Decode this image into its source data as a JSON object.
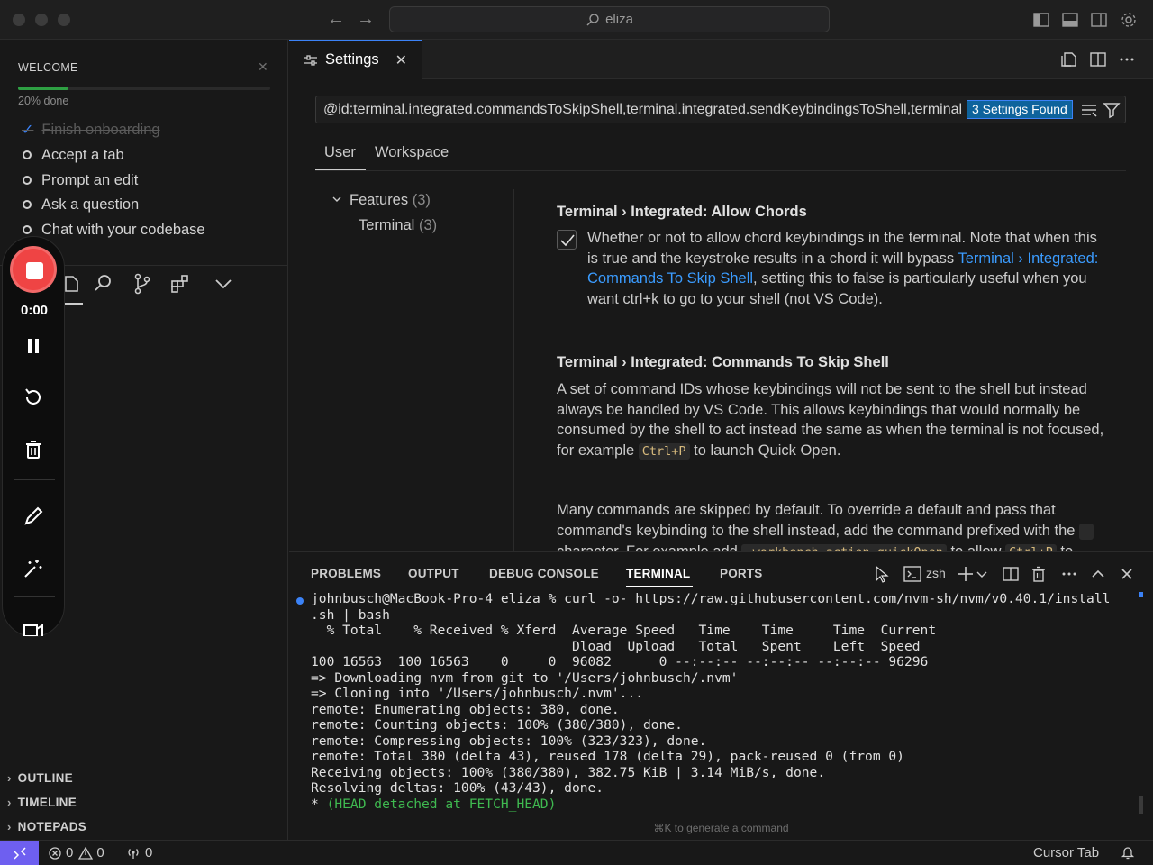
{
  "titlebar": {
    "search_text": "eliza",
    "back_arrow": "←",
    "forward_arrow": "→"
  },
  "welcome": {
    "title": "WELCOME",
    "progress_label": "20% done",
    "progress_fraction": 0.2,
    "items": [
      {
        "label": "Finish onboarding",
        "done": true
      },
      {
        "label": "Accept a tab",
        "done": false
      },
      {
        "label": "Prompt an edit",
        "done": false
      },
      {
        "label": "Ask a question",
        "done": false
      },
      {
        "label": "Chat with your codebase",
        "done": false
      }
    ]
  },
  "sidebar_sections": {
    "outline": "OUTLINE",
    "timeline": "TIMELINE",
    "notepads": "NOTEPADS"
  },
  "recorder": {
    "time": "0:00"
  },
  "editor": {
    "tab_label": "Settings"
  },
  "settings": {
    "query": "@id:terminal.integrated.commandsToSkipShell,terminal.integrated.sendKeybindingsToShell,terminal.integrated.allowChords",
    "found_badge": "3 Settings Found",
    "scope_tabs": [
      "User",
      "Workspace"
    ],
    "tree": {
      "features": "Features",
      "features_count": "(3)",
      "terminal": "Terminal",
      "terminal_count": "(3)"
    },
    "allow_chords": {
      "title": "Terminal › Integrated: Allow Chords",
      "checked": true,
      "desc_1": "Whether or not to allow chord keybindings in the terminal. Note that when this is true and the keystroke results in a chord it will bypass ",
      "link": "Terminal › Integrated: Commands To Skip Shell",
      "desc_2": ", setting this to false is particularly useful when you want ctrl+k to go to your shell (not VS Code)."
    },
    "skip_shell": {
      "title": "Terminal › Integrated: Commands To Skip Shell",
      "desc_1": "A set of command IDs whose keybindings will not be sent to the shell but instead always be handled by VS Code. This allows keybindings that would normally be consumed by the shell to act instead the same as when the terminal is not focused, for example ",
      "kbd_1": "Ctrl+P",
      "desc_2": " to launch Quick Open.",
      "desc_3": "Many commands are skipped by default. To override a default and pass that command's keybinding to the shell instead, add the command prefixed with the ",
      "desc_4": " character. For example add ",
      "kbd_2": "-workbench.action.quickOpen",
      "desc_5": " to allow ",
      "kbd_3": "Ctrl+P",
      "desc_6": " to"
    }
  },
  "panel": {
    "tabs": [
      "PROBLEMS",
      "OUTPUT",
      "DEBUG CONSOLE",
      "TERMINAL",
      "PORTS"
    ],
    "active_tab": "TERMINAL",
    "shell": "zsh",
    "hint": "⌘K to generate a command",
    "terminal_lines": [
      "johnbusch@MacBook-Pro-4 eliza % curl -o- https://raw.githubusercontent.com/nvm-sh/nvm/v0.40.1/install",
      ".sh | bash",
      "  % Total    % Received % Xferd  Average Speed   Time    Time     Time  Current",
      "                                 Dload  Upload   Total   Spent    Left  Speed",
      "100 16563  100 16563    0     0  96082      0 --:--:-- --:--:-- --:--:-- 96296",
      "=> Downloading nvm from git to '/Users/johnbusch/.nvm'",
      "=> Cloning into '/Users/johnbusch/.nvm'...",
      "remote: Enumerating objects: 380, done.",
      "remote: Counting objects: 100% (380/380), done.",
      "remote: Compressing objects: 100% (323/323), done.",
      "remote: Total 380 (delta 43), reused 178 (delta 29), pack-reused 0 (from 0)",
      "Receiving objects: 100% (380/380), 382.75 KiB | 3.14 MiB/s, done.",
      "Resolving deltas: 100% (43/43), done."
    ],
    "terminal_last_prefix": "* ",
    "terminal_last_green": "(HEAD detached at FETCH_HEAD)"
  },
  "statusbar": {
    "errors": "0",
    "warnings": "0",
    "ports": "0",
    "cursor_tab": "Cursor Tab"
  },
  "colors": {
    "accent": "#3b82f6",
    "record": "#ef4444",
    "progress": "#2ea043",
    "remote": "#6e5ff0"
  }
}
